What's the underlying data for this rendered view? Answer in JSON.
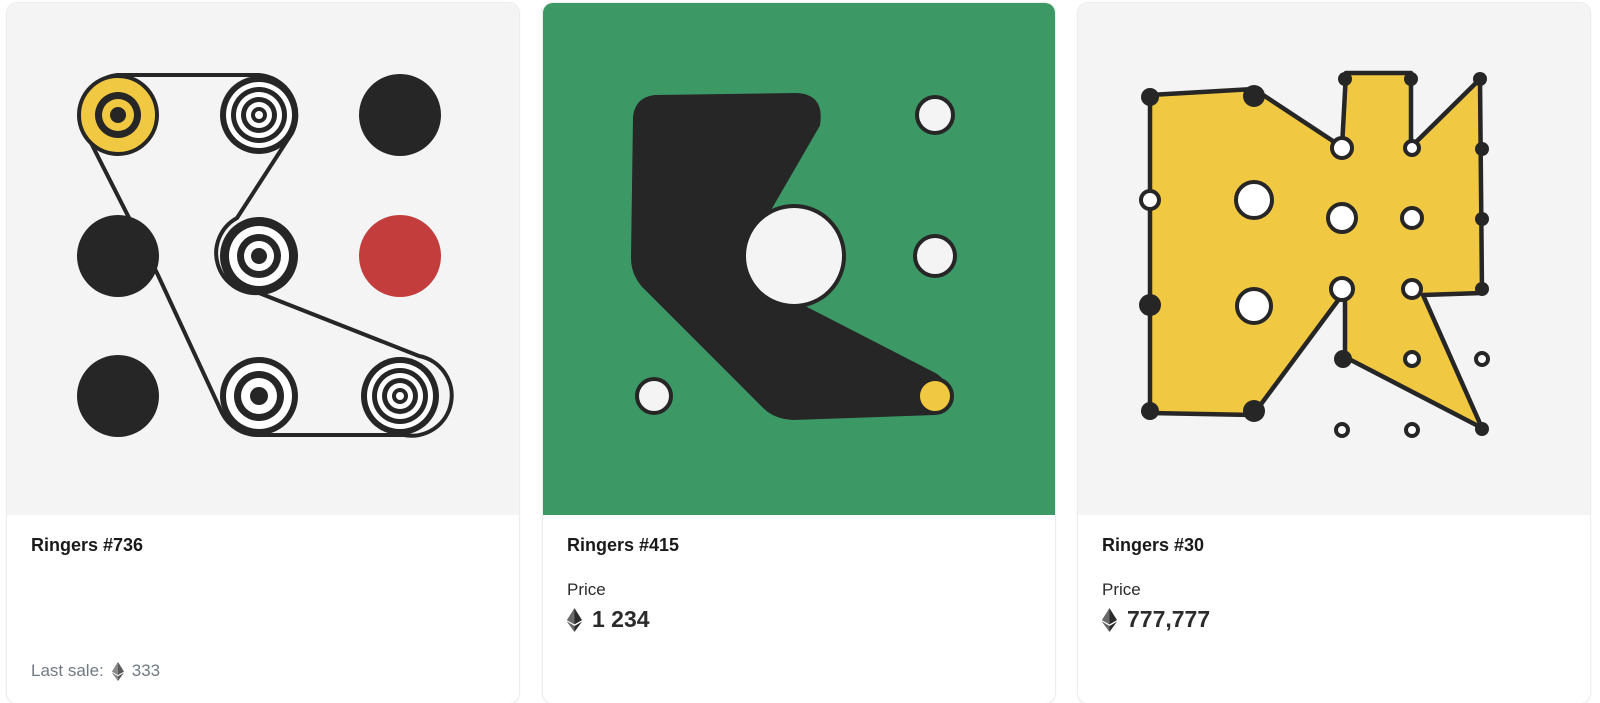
{
  "cards": [
    {
      "name": "Ringers #736",
      "last_sale_label": "Last sale:",
      "last_sale_value": "333",
      "background": "#f4f4f4"
    },
    {
      "name": "Ringers #415",
      "price_label": "Price",
      "price_value": "1 234",
      "background": "#3c9966"
    },
    {
      "name": "Ringers #30",
      "price_label": "Price",
      "price_value": "777,777",
      "background": "#f4f4f4"
    }
  ],
  "icons": {
    "currency": "ethereum-icon"
  },
  "colors": {
    "ink": "#262626",
    "yellow": "#f0c842",
    "red": "#c23d3b",
    "green": "#3c9966"
  }
}
